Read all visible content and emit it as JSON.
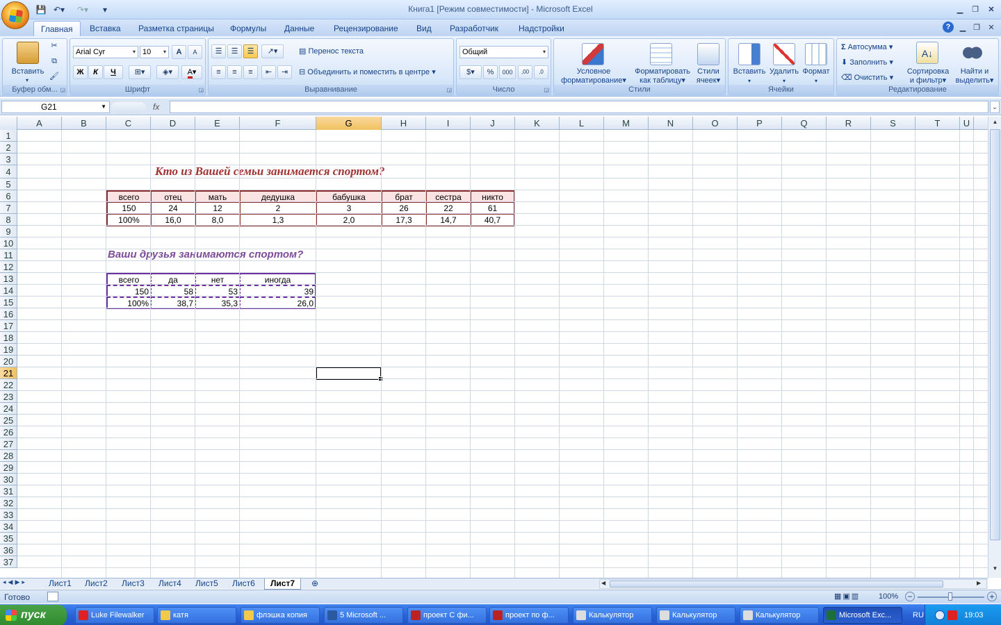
{
  "window": {
    "title": "Книга1  [Режим совместимости] - Microsoft Excel"
  },
  "ribbon_tabs": [
    "Главная",
    "Вставка",
    "Разметка страницы",
    "Формулы",
    "Данные",
    "Рецензирование",
    "Вид",
    "Разработчик",
    "Надстройки"
  ],
  "groups": {
    "clipboard": "Буфер обм...",
    "font": "Шрифт",
    "alignment": "Выравнивание",
    "number": "Число",
    "styles": "Стили",
    "cells": "Ячейки",
    "editing": "Редактирование"
  },
  "clipboard": {
    "paste": "Вставить"
  },
  "font": {
    "name": "Arial Cyr",
    "size": "10",
    "bold": "Ж",
    "italic": "К",
    "underline": "Ч",
    "grow": "A",
    "shrink": "A",
    "color": "A"
  },
  "alignment": {
    "wrap": "Перенос текста",
    "merge": "Объединить и поместить в центре"
  },
  "number": {
    "format": "Общий",
    "percent": "%",
    "thousands": "000",
    "inc": ",00",
    "dec": ",0"
  },
  "styles": {
    "conditional_1": "Условное",
    "conditional_2": "форматирование",
    "table_1": "Форматировать",
    "table_2": "как таблицу",
    "cell_1": "Стили",
    "cell_2": "ячеек"
  },
  "cells": {
    "insert": "Вставить",
    "delete": "Удалить",
    "format": "Формат"
  },
  "editing": {
    "autosum": "Автосумма",
    "fill": "Заполнить",
    "clear": "Очистить",
    "sort_1": "Сортировка",
    "sort_2": "и фильтр",
    "find_1": "Найти и",
    "find_2": "выделить"
  },
  "formula_bar": {
    "name_box": "G21",
    "fx": "fx",
    "value": ""
  },
  "columns": [
    "A",
    "B",
    "C",
    "D",
    "E",
    "F",
    "G",
    "H",
    "I",
    "J",
    "K",
    "L",
    "M",
    "N",
    "O",
    "P",
    "Q",
    "R",
    "S",
    "T",
    "U"
  ],
  "rows": [
    "1",
    "2",
    "3",
    "4",
    "5",
    "6",
    "7",
    "8",
    "9",
    "10",
    "11",
    "12",
    "13",
    "14",
    "15",
    "16",
    "17",
    "18",
    "19",
    "20",
    "21",
    "22",
    "23",
    "24",
    "25",
    "26",
    "27",
    "28",
    "29",
    "30",
    "31",
    "32",
    "33",
    "34",
    "35",
    "36",
    "37"
  ],
  "table1": {
    "title": "Кто из Вашей семьи занимается спортом?",
    "header": [
      "всего",
      "отец",
      "мать",
      "дедушка",
      "бабушка",
      "брат",
      "сестра",
      "никто"
    ],
    "counts": [
      "150",
      "24",
      "12",
      "2",
      "3",
      "26",
      "22",
      "61"
    ],
    "percents": [
      "100%",
      "16,0",
      "8,0",
      "1,3",
      "2,0",
      "17,3",
      "14,7",
      "40,7"
    ]
  },
  "table2": {
    "title": "Ваши друзья занимаются спортом?",
    "header": [
      "всего",
      "да",
      "нет",
      "иногда"
    ],
    "counts": [
      "150",
      "58",
      "53",
      "39"
    ],
    "percents": [
      "100%",
      "38,7",
      "35,3",
      "26,0"
    ]
  },
  "sheet_tabs": [
    "Лист1",
    "Лист2",
    "Лист3",
    "Лист4",
    "Лист5",
    "Лист6",
    "Лист7"
  ],
  "active_sheet": "Лист7",
  "status": {
    "ready": "Готово",
    "zoom": "100%"
  },
  "taskbar": {
    "start": "пуск",
    "items": [
      "Luke Filewalker",
      "катя",
      "флэшка копия",
      "5 Microsoft ...",
      "проект С фи...",
      "проект по ф...",
      "Калькулятор",
      "Калькулятор",
      "Калькулятор",
      "Microsoft Exc..."
    ],
    "lang": "RU",
    "clock": "19:03"
  }
}
